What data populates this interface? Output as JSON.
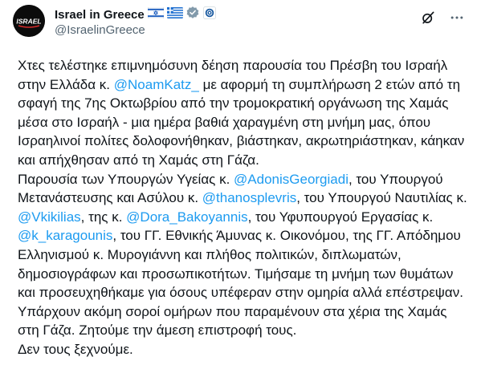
{
  "account": {
    "display_name": "Israel in Greece",
    "handle": "@IsraelinGreece",
    "avatar_text": "ISRAEL"
  },
  "colors": {
    "mention": "#1d9bf0",
    "text": "#0f1419",
    "muted": "#536471"
  },
  "icons": {
    "flags": [
      "israel-flag-icon",
      "greece-flag-icon"
    ],
    "badges": [
      "verified-badge-icon",
      "affiliate-badge-icon"
    ],
    "actions": [
      "grok-icon",
      "more-icon"
    ]
  },
  "tweet": {
    "segments": [
      {
        "text": "Χτες τελέστηκε επιμνημόσυνη δέηση παρουσία του Πρέσβη του Ισραήλ στην Ελλάδα κ. ",
        "mention": false
      },
      {
        "text": "@NoamKatz_",
        "mention": true
      },
      {
        "text": " με αφορμή τη συμπλήρωση 2 ετών από τη σφαγή της 7ης Οκτωβρίου από την τρομοκρατική οργάνωση της Χαμάς μέσα στο Ισραήλ - μια ημέρα βαθιά χαραγμένη στη μνήμη μας, όπου Ισραηλινοί πολίτες δολοφονήθηκαν, βιάστηκαν, ακρωτηριάστηκαν, κάηκαν και απήχθησαν από τη Χαμάς στη Γάζα.\nΠαρουσία των Υπουργών Υγείας κ. ",
        "mention": false
      },
      {
        "text": "@AdonisGeorgiadi",
        "mention": true
      },
      {
        "text": ", του Υπουργού Μετανάστευσης και Ασύλου κ. ",
        "mention": false
      },
      {
        "text": "@thanosplevris",
        "mention": true
      },
      {
        "text": ", του Υπουργού Ναυτιλίας κ. ",
        "mention": false
      },
      {
        "text": "@Vkikilias",
        "mention": true
      },
      {
        "text": ", της κ. ",
        "mention": false
      },
      {
        "text": "@Dora_Bakoyannis",
        "mention": true
      },
      {
        "text": ", του Υφυπουργού Εργασίας κ. ",
        "mention": false
      },
      {
        "text": "@k_karagounis",
        "mention": true
      },
      {
        "text": ", του ΓΓ. Εθνικής Άμυνας κ. Οικονόμου, της ΓΓ. Απόδημου Ελληνισμού κ. Μυρογιάννη και πλήθος πολιτικών, διπλωματών, δημοσιογράφων και προσωπικοτήτων. Τιμήσαμε τη μνήμη των θυμάτων και προσευχηθήκαμε για όσους υπέφεραν στην ομηρία αλλά επέστρεψαν.\nΥπάρχουν ακόμη σοροί ομήρων που παραμένουν στα χέρια της Χαμάς στη Γάζα. Ζητούμε την άμεση επιστροφή τους.\nΔεν τους ξεχνούμε.",
        "mention": false
      }
    ]
  }
}
